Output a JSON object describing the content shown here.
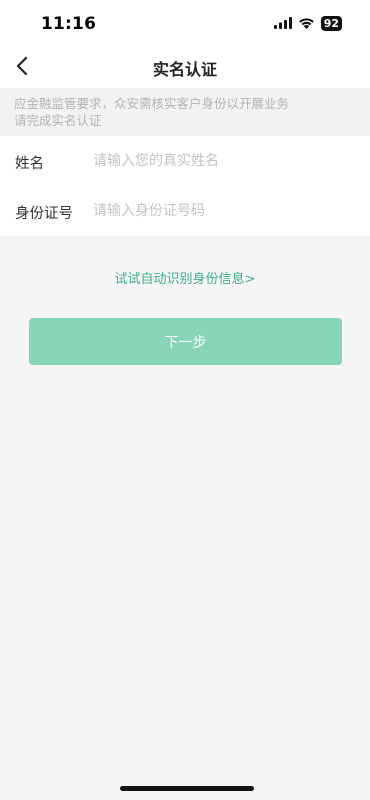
{
  "status_bar": {
    "time": "11:16",
    "battery": "92",
    "icons": [
      "signal-icon",
      "wifi-icon",
      "battery-icon"
    ]
  },
  "nav": {
    "title": "实名认证",
    "back_icon": "chevron-left-icon"
  },
  "notice": {
    "line1": "应金融监管要求，众安需核实客户身份以开展业务",
    "line2": "请完成实名认证"
  },
  "form": {
    "name_label": "姓名",
    "name_placeholder": "请输入您的真实姓名",
    "name_value": "",
    "id_label": "身份证号",
    "id_placeholder": "请输入身份证号码",
    "id_value": ""
  },
  "auto_recognize_link": "试试自动识别身份信息>",
  "next_button": "下一步",
  "colors": {
    "accent": "#3fb183",
    "button_disabled": "#86d6b6",
    "page_background": "#f5f5f5"
  }
}
